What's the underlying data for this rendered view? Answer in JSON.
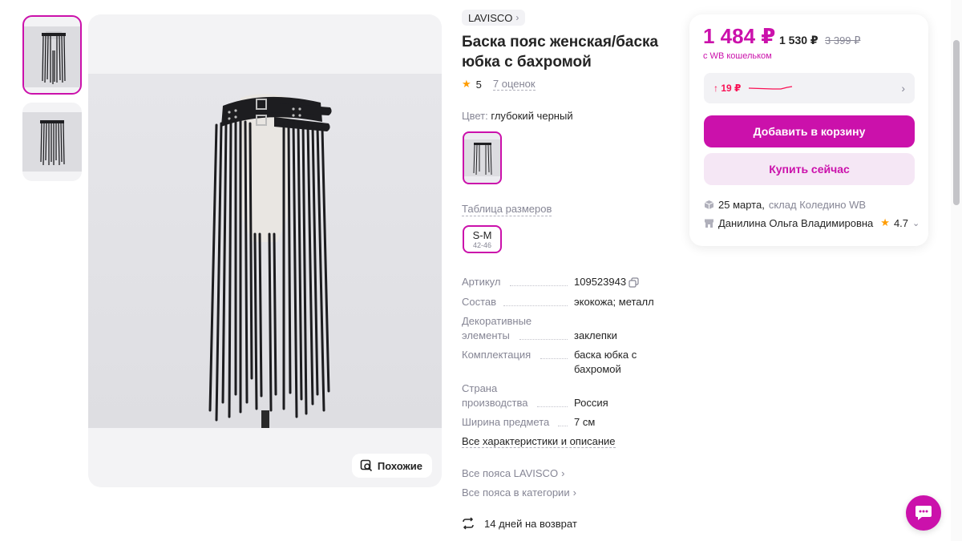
{
  "gallery": {
    "thumbnails": [
      "photo-1",
      "photo-2"
    ],
    "similar_label": "Похожие"
  },
  "product": {
    "brand": "LAVISCO",
    "title": "Баска пояс женская/баска юбка с бахромой",
    "rating": "5",
    "reviews": "7 оценок",
    "color_label": "Цвет:",
    "color_value": "глубокий черный",
    "size_table_label": "Таблица размеров",
    "size": {
      "name": "S-M",
      "range": "42-46"
    }
  },
  "specs": [
    {
      "key": "Артикул",
      "value": "109523943"
    },
    {
      "key": "Состав",
      "value": "экокожа; металл"
    },
    {
      "key": "Декоративные элементы",
      "value": "заклепки"
    },
    {
      "key": "Комплектация",
      "value": "баска юбка с бахромой"
    },
    {
      "key": "Страна производства",
      "value": "Россия"
    },
    {
      "key": "Ширина предмета",
      "value": "7 см"
    }
  ],
  "links": {
    "all_specs": "Все характеристики и описание",
    "brand_belts": "Все пояса LAVISCO",
    "category_belts": "Все пояса в категории",
    "returns": "14 дней на возврат"
  },
  "buy_card": {
    "price_wallet": "1 484 ₽",
    "price_regular": "1 530 ₽",
    "price_old": "3 399 ₽",
    "wallet_note": "с WB кошельком",
    "price_delta": "↑ 19 ₽",
    "add_to_cart": "Добавить в корзину",
    "buy_now": "Купить сейчас",
    "delivery_date": "25 марта,",
    "warehouse": "склад Коледино WB",
    "seller_name": "Данилина Ольга Владимировна",
    "seller_rating": "4.7"
  },
  "colors": {
    "accent": "#cb11ab",
    "accent_light": "#f5e7f5",
    "price_up": "#f91155",
    "star": "#ff9c00",
    "muted": "#868695"
  }
}
